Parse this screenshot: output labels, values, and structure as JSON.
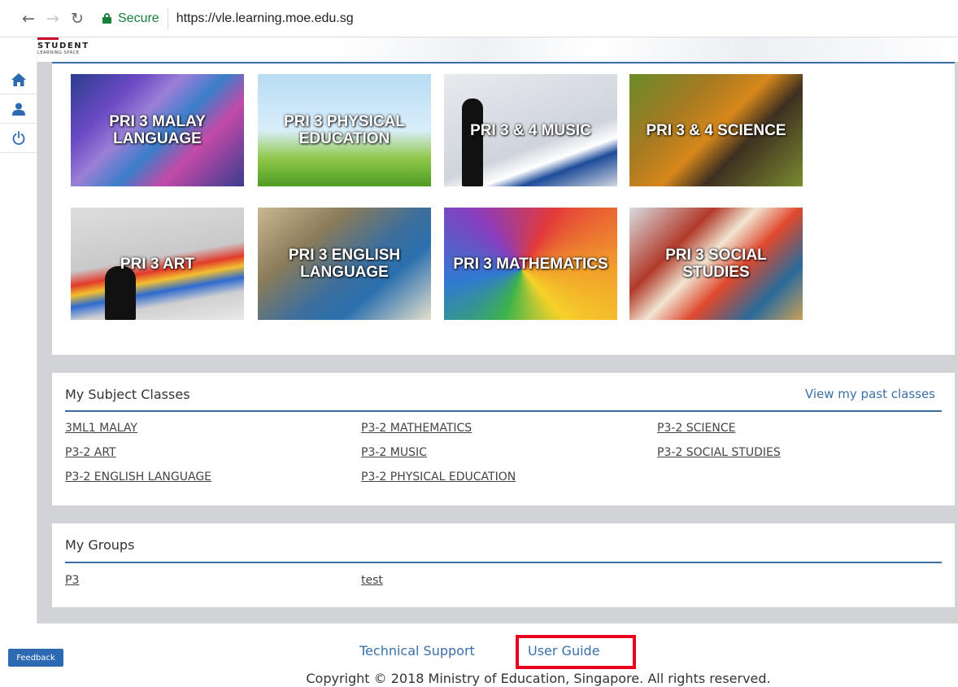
{
  "browser": {
    "back_icon": "arrow-left-icon",
    "forward_icon": "arrow-right-icon",
    "reload_icon": "reload-icon",
    "secure_label": "Secure",
    "url": "https://vle.learning.moe.edu.sg"
  },
  "header": {
    "logo_main": "STUDENT",
    "logo_sub": "LEARNING SPACE"
  },
  "sidebar": {
    "items": [
      {
        "icon": "home-icon"
      },
      {
        "icon": "user-icon"
      },
      {
        "icon": "power-icon"
      }
    ]
  },
  "subject_tiles": [
    {
      "label": "PRI 3 MALAY LANGUAGE"
    },
    {
      "label": "PRI 3 PHYSICAL EDUCATION"
    },
    {
      "label": "PRI 3 & 4 MUSIC"
    },
    {
      "label": "PRI 3 & 4 SCIENCE"
    },
    {
      "label": "PRI 3 ART"
    },
    {
      "label": "PRI 3 ENGLISH LANGUAGE"
    },
    {
      "label": "PRI 3 MATHEMATICS"
    },
    {
      "label": "PRI 3 SOCIAL STUDIES"
    }
  ],
  "subject_classes": {
    "title": "My Subject Classes",
    "view_past": "View my past classes",
    "links": [
      "3ML1 MALAY",
      "P3-2 MATHEMATICS",
      "P3-2 SCIENCE",
      "P3-2 ART",
      "P3-2 MUSIC",
      "P3-2 SOCIAL STUDIES",
      "P3-2 ENGLISH LANGUAGE",
      "P3-2 PHYSICAL EDUCATION"
    ]
  },
  "groups": {
    "title": "My Groups",
    "links": [
      "P3",
      "test"
    ]
  },
  "footer": {
    "technical_support": "Technical Support",
    "user_guide": "User Guide",
    "copyright": "Copyright © 2018 Ministry of Education, Singapore. All rights reserved.",
    "highlight_color": "#e8001c"
  },
  "feedback": {
    "label": "Feedback"
  },
  "colors": {
    "accent": "#3a6fa5",
    "link": "#3a70a8",
    "secure": "#188038",
    "sidebar_icon": "#2c6ab2"
  }
}
